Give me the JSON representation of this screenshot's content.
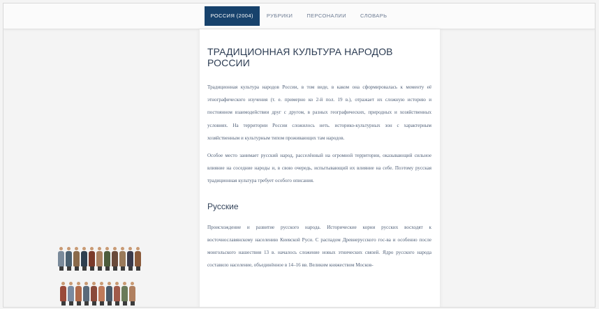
{
  "nav": {
    "items": [
      {
        "label": "РОССИЯ (2004)",
        "active": true
      },
      {
        "label": "РУБРИКИ",
        "active": false
      },
      {
        "label": "ПЕРСОНАЛИИ",
        "active": false
      },
      {
        "label": "СЛОВАРЬ",
        "active": false
      }
    ]
  },
  "article": {
    "title": "ТРАДИЦИОННАЯ КУЛЬТУРА НАРОДОВ РОССИИ",
    "paragraphs": [
      "Традиционная культура народов России, в том виде, в каком она сформировалась к моменту её этнографического изучения (т. е. примерно ко 2-й пол. 19 в.), отражает их сложную историю и постоянном взаимодействии друг с другом, в разных географических, природных и хозяйственных условиях. На территории России сложилось неть. историко-культурных зон с характерным хозяйственным и культурным типом проживающих там народов.",
      "Особое место занимает русский народ, расселённый на огромной территории, оказывающий сильное влияние на соседние народы и, в свою очередь, испытывающий их влияние на себе. Поэтому русская традиционная культура требует особого описания."
    ],
    "section_title": "Русские",
    "section_paragraph": "Происхождение и развитие русского народа. Исторические корни русских восходят к восточнославянскому населению Киевской Руси. С распадом Древнерусского гос-ва и особенно после монгольского нашествия 13 в. началось сложение новых этнических связей. Ядро русского народа составило население, объединённое в 14–16 вв. Великим княжеством Москов-"
  },
  "illustration": {
    "icon": "folk-costumes-illustration",
    "row1_colors": [
      "#7a8a9a",
      "#4a6070",
      "#8a6a4a",
      "#2f3f4f",
      "#7b3b2b",
      "#a88060",
      "#4c5c3c",
      "#6a4a3a",
      "#9a7a5a",
      "#3a3a4a",
      "#8a5a3a"
    ],
    "row2_colors": [
      "#9a4a3a",
      "#7a8aa0",
      "#b06a4a",
      "#5a6a7a",
      "#8a4a3a",
      "#c07a5a",
      "#4a5a6a",
      "#a05a4a",
      "#6a7a5a",
      "#b08060"
    ]
  }
}
